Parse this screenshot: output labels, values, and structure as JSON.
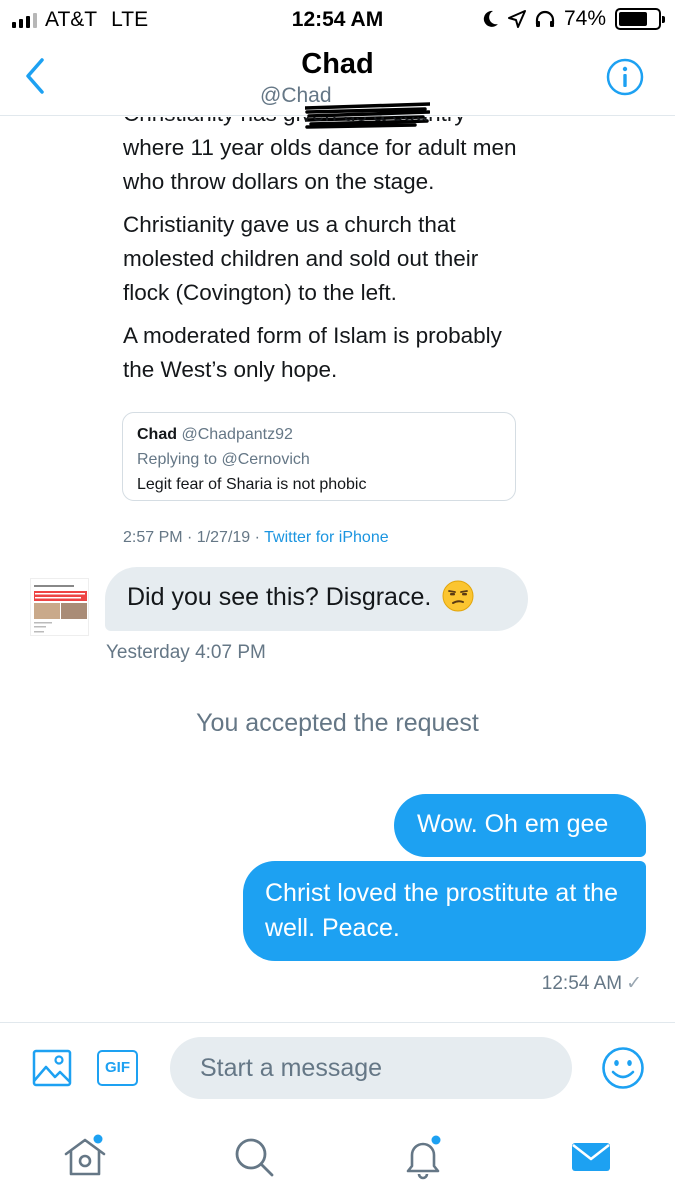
{
  "status_bar": {
    "carrier": "AT&T",
    "network": "LTE",
    "time": "12:54 AM",
    "battery": "74%",
    "battery_level": 0.74
  },
  "header": {
    "name": "Chad",
    "handle": "@Chad",
    "accent_color": "#1da1f2"
  },
  "conversation": {
    "tweet": {
      "cut_line": "Christianity has given us a country",
      "paragraphs": [
        "where 11 year olds dance for adult men who throw dollars on the stage.",
        "Christianity gave us a church that molested children and sold out their flock (Covington) to the left.",
        "A moderated form of Islam is probably the West’s only hope."
      ],
      "quote": {
        "name": "Chad",
        "handle": "@Chadpantz92",
        "replying_to": "Replying to @Cernovich",
        "text": "Legit fear of Sharia is not phobic"
      },
      "time": "2:57 PM · 1/27/19",
      "via": "Twitter for iPhone"
    },
    "incoming": {
      "text": "Did you see this? Disgrace.",
      "emoji": "unamused-face-emoji",
      "timestamp": "Yesterday 4:07 PM"
    },
    "system_message": "You accepted the request",
    "outgoing": [
      {
        "text": "Wow. Oh em gee"
      },
      {
        "text": "Christ loved the prostitute at the well. Peace."
      }
    ],
    "outgoing_timestamp": "12:54 AM",
    "outgoing_status_icon": "checkmark-icon"
  },
  "composer": {
    "placeholder": "Start a message",
    "gif_label": "GIF"
  },
  "tabs": [
    {
      "name": "home",
      "icon": "home-icon",
      "has_dot": true
    },
    {
      "name": "search",
      "icon": "search-icon",
      "has_dot": false
    },
    {
      "name": "notifications",
      "icon": "bell-icon",
      "has_dot": true
    },
    {
      "name": "messages",
      "icon": "envelope-icon",
      "active": true
    }
  ]
}
